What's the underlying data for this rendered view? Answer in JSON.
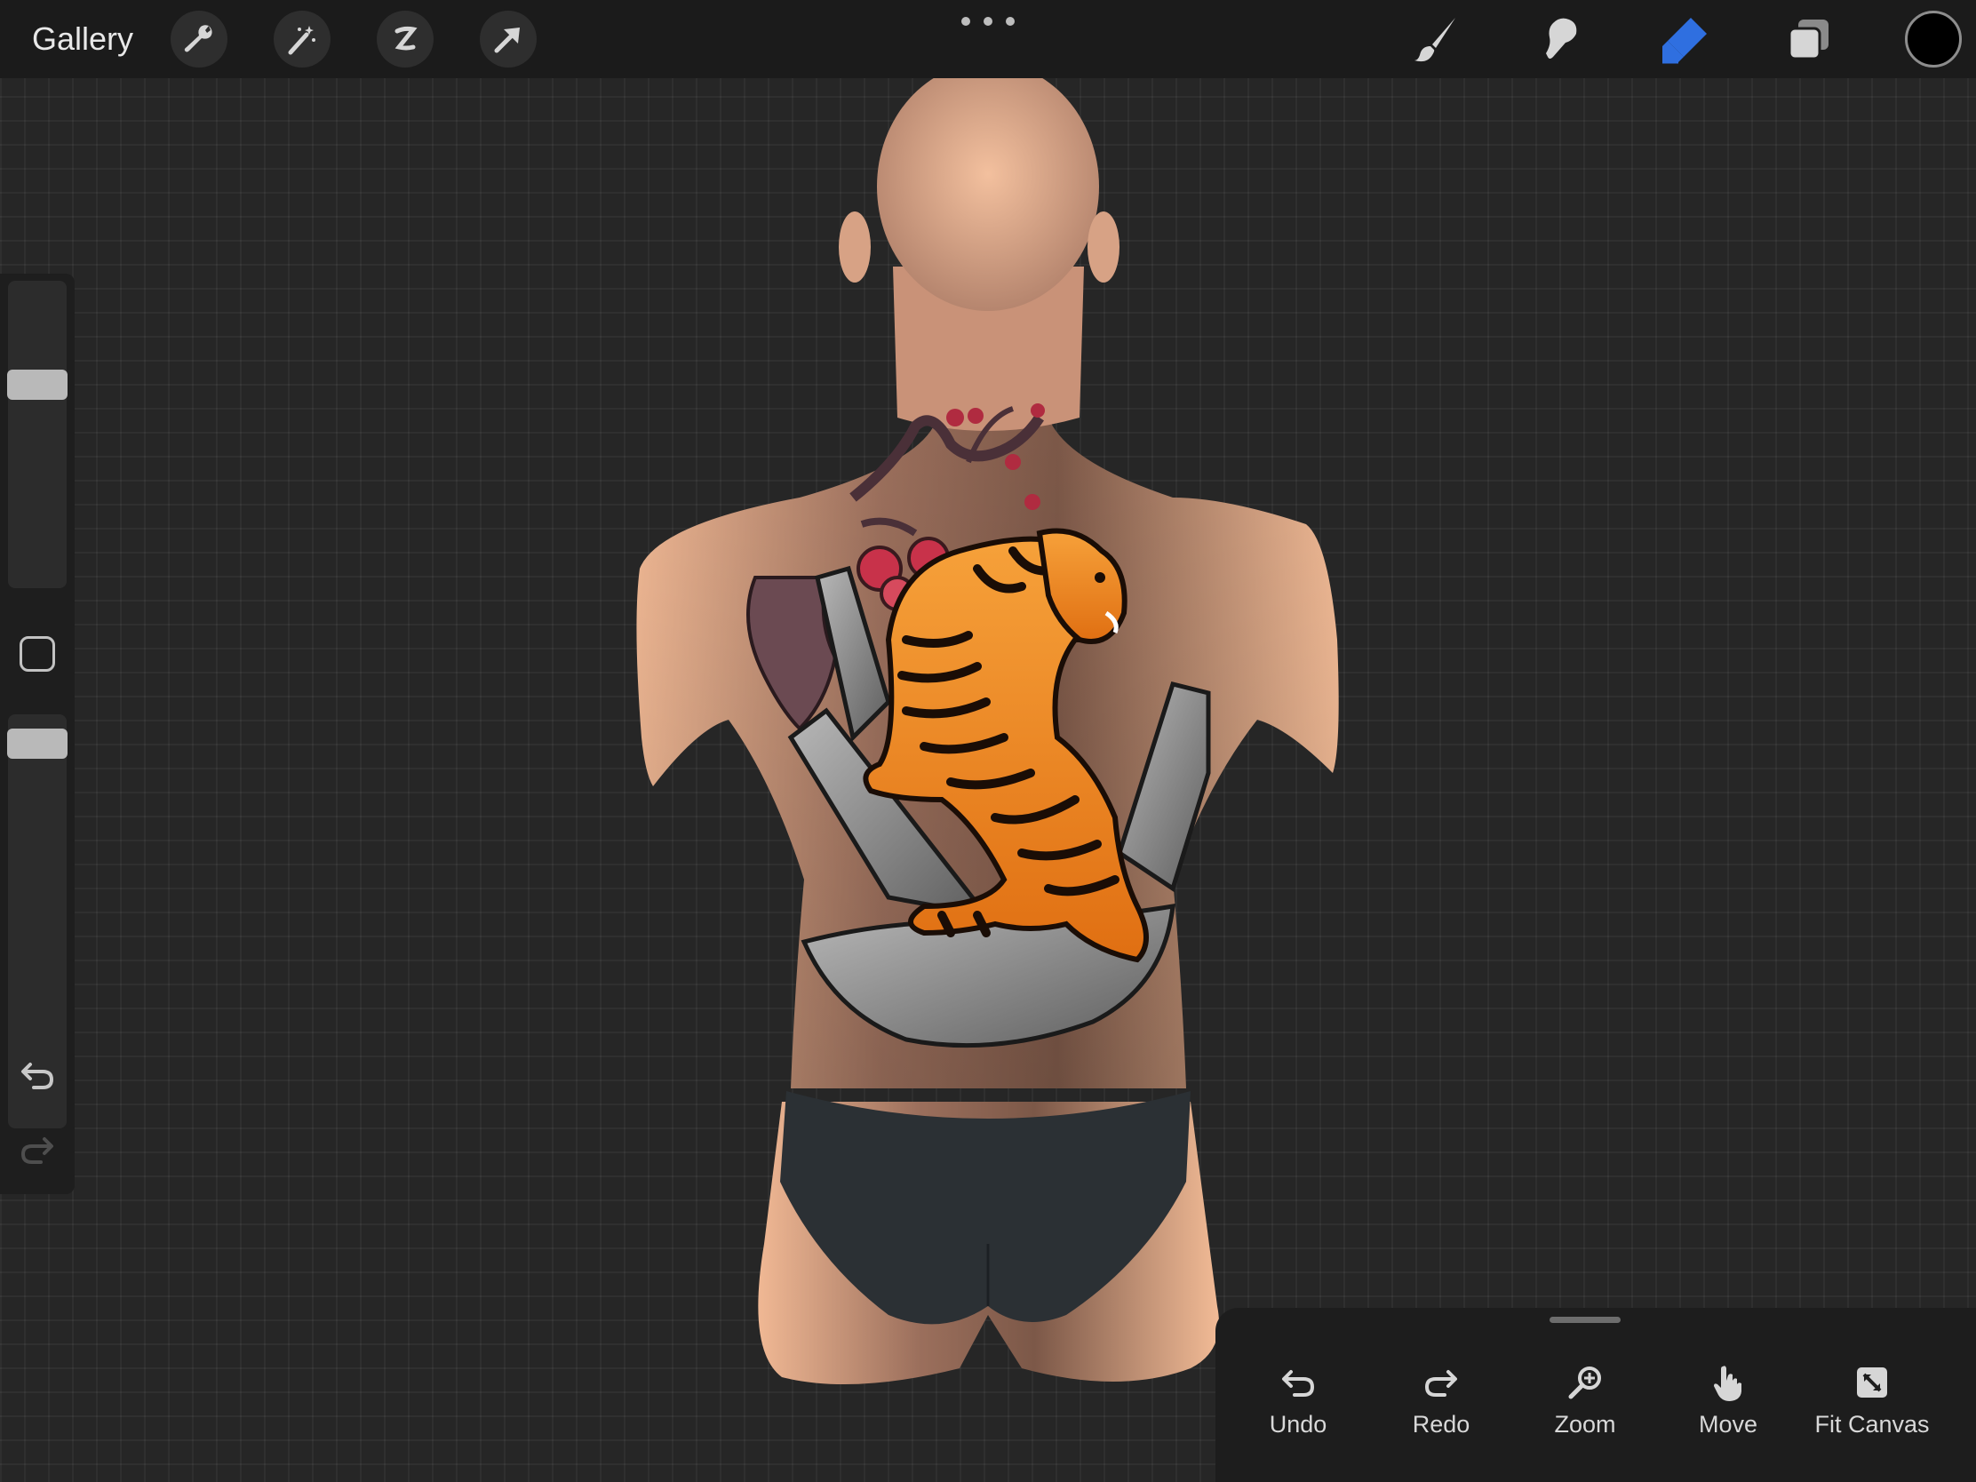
{
  "topbar": {
    "gallery_label": "Gallery",
    "left_tools": [
      "wrench-icon",
      "magic-wand-icon",
      "selection-icon",
      "transform-arrow-icon"
    ],
    "right_tools": [
      "brush-icon",
      "smudge-icon",
      "eraser-icon",
      "layers-icon"
    ],
    "active_tool": "eraser",
    "accent_color": "#2f6fe0",
    "current_color": "#000000"
  },
  "sidebar": {
    "brush_size_level": 0.63,
    "opacity_level": 0.8,
    "icons": [
      "modifier-square-icon",
      "undo-arrow-icon",
      "redo-arrow-icon"
    ]
  },
  "quick_menu": {
    "items": [
      {
        "label": "Undo",
        "icon": "undo-icon"
      },
      {
        "label": "Redo",
        "icon": "redo-icon"
      },
      {
        "label": "Zoom",
        "icon": "zoom-icon"
      },
      {
        "label": "Move",
        "icon": "hand-icon"
      },
      {
        "label": "Fit Canvas",
        "icon": "fit-canvas-icon"
      }
    ]
  },
  "colors": {
    "canvas_bg": "#262626",
    "skin_light": "#f2b995",
    "skin_dark": "#7e5a4a",
    "tiger_orange": "#f08a1e",
    "rock_gray": "#8e8e8e",
    "blossom_red": "#c8324a"
  }
}
